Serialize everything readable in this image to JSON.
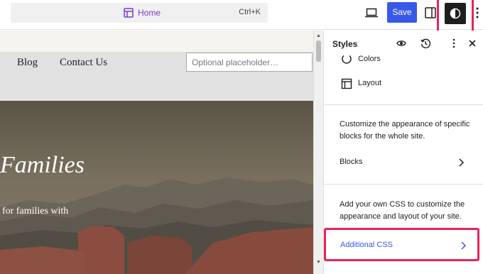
{
  "topbar": {
    "command_title": "Home",
    "command_shortcut": "Ctrl+K",
    "save_label": "Save"
  },
  "site": {
    "nav_items": [
      "Blog",
      "Contact Us"
    ],
    "search_placeholder": "Optional placeholder…",
    "hero_title": "Families",
    "hero_subtitle": "for families with"
  },
  "panel": {
    "title": "Styles",
    "items": [
      {
        "label": "Colors",
        "icon": "colors-icon"
      },
      {
        "label": "Layout",
        "icon": "layout-icon"
      }
    ],
    "blocks_description": "Customize the appearance of specific blocks for the whole site.",
    "blocks_label": "Blocks",
    "css_description": "Add your own CSS to customize the appearance and layout of your site.",
    "additional_css_label": "Additional CSS"
  },
  "colors": {
    "accent": "#3858e9",
    "highlight": "#e6245a",
    "command_title": "#7a3cc7"
  }
}
